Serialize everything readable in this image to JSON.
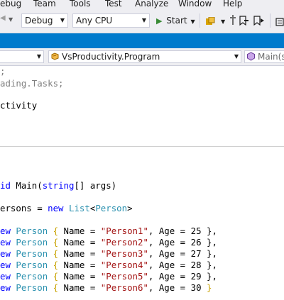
{
  "menu": {
    "items": [
      "ebug",
      "Team",
      "Tools",
      "Test",
      "Analyze",
      "Window",
      "Help"
    ]
  },
  "toolbar": {
    "config": "Debug",
    "platform": "Any CPU",
    "start_label": "Start"
  },
  "navbar": {
    "class_selector": "VsProductivity.Program",
    "member_selector": "Main(s"
  },
  "code": {
    "line1": ";",
    "line2_text": "ading.Tasks;",
    "line3_text": "ctivity",
    "main_kw": "id",
    "main_name": " Main(",
    "main_type": "string",
    "main_rest": "[] args)",
    "persons_text": "ersons = ",
    "new_kw": "new",
    "list_type": "List",
    "person_type": "Person",
    "lt": "<",
    "gt": ">",
    "rows": [
      {
        "prefix": "ew",
        "type": "Person",
        "name": "\"Person1\"",
        "age": "25",
        "end": "},"
      },
      {
        "prefix": "ew",
        "type": "Person",
        "name": "\"Person2\"",
        "age": "26",
        "end": "},"
      },
      {
        "prefix": "ew",
        "type": "Person",
        "name": "\"Person3\"",
        "age": "27",
        "end": "},"
      },
      {
        "prefix": "ew",
        "type": "Person",
        "name": "\"Person4\"",
        "age": "28",
        "end": "},"
      },
      {
        "prefix": "ew",
        "type": "Person",
        "name": "\"Person5\"",
        "age": "29",
        "end": "},"
      },
      {
        "prefix": "ew",
        "type": "Person",
        "name": "\"Person6\"",
        "age": "30",
        "end": "}"
      }
    ]
  },
  "colors": {
    "accent": "#007acc",
    "keyword": "#0000ff",
    "type": "#2b91af",
    "string": "#a31515"
  }
}
